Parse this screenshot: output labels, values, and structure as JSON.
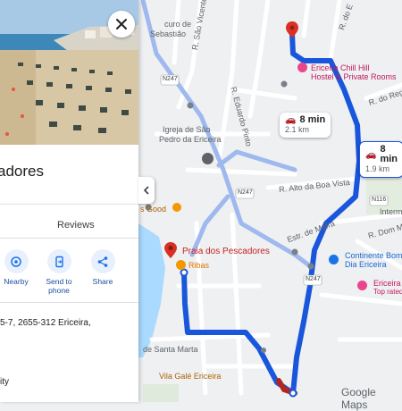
{
  "place": {
    "title": "adores",
    "tabs": [
      "Reviews"
    ],
    "actions": [
      {
        "label": "Nearby",
        "icon": "nearby-icon"
      },
      {
        "label": "Send to phone",
        "icon": "send-to-phone-icon"
      },
      {
        "label": "Share",
        "icon": "share-icon"
      }
    ],
    "address": "5-7, 2655-312 Ericeira,",
    "accessibility": "ity"
  },
  "map": {
    "labels": {
      "curo": "curo de",
      "sebastiao": "Sebastião",
      "sao_vicente": "R. São Vicente",
      "eduardo": "R. Eduardo Pinto",
      "igreja": "Igreja de São",
      "pedro": "Pedro da Ericeira",
      "boa_vista": "R. Alto da Boa Vista",
      "mafra": "Estr. de Mafra",
      "dom_manuel": "R. Dom Manuel II",
      "santa_marta": "de Santa Marta",
      "regedor": "R. do Reg",
      "r_do_e": "R. do E",
      "interm": "Interm",
      "good": "s Good",
      "vila_gale": "Vila Galé Ericeira",
      "road_n247_top": "N247",
      "road_n247_mid": "N247",
      "road_n247_low": "N247",
      "road_n116": "N116"
    },
    "pois": {
      "hostel_line1": "Ericeira Chill Hill",
      "hostel_line2": "Hostel & Private Rooms",
      "praia": "Praia dos Pescadores",
      "ribas": "Ribas",
      "continente_line1": "Continente Bom",
      "continente_line2": "Dia Ericeira",
      "ericeira_line1": "Ericeira",
      "ericeira_line2": "Top rated"
    },
    "routes": [
      {
        "time": "8 min",
        "distance": "2.1 km",
        "mode": "car-icon",
        "selected": false
      },
      {
        "time": "8 min",
        "distance": "1.9 km",
        "mode": "car-icon",
        "selected": true
      }
    ],
    "footer": "Google Maps",
    "colors": {
      "route": "#1a56db",
      "route_alt": "#8faef3",
      "pin": "#d93025",
      "water": "#aadaff"
    }
  }
}
